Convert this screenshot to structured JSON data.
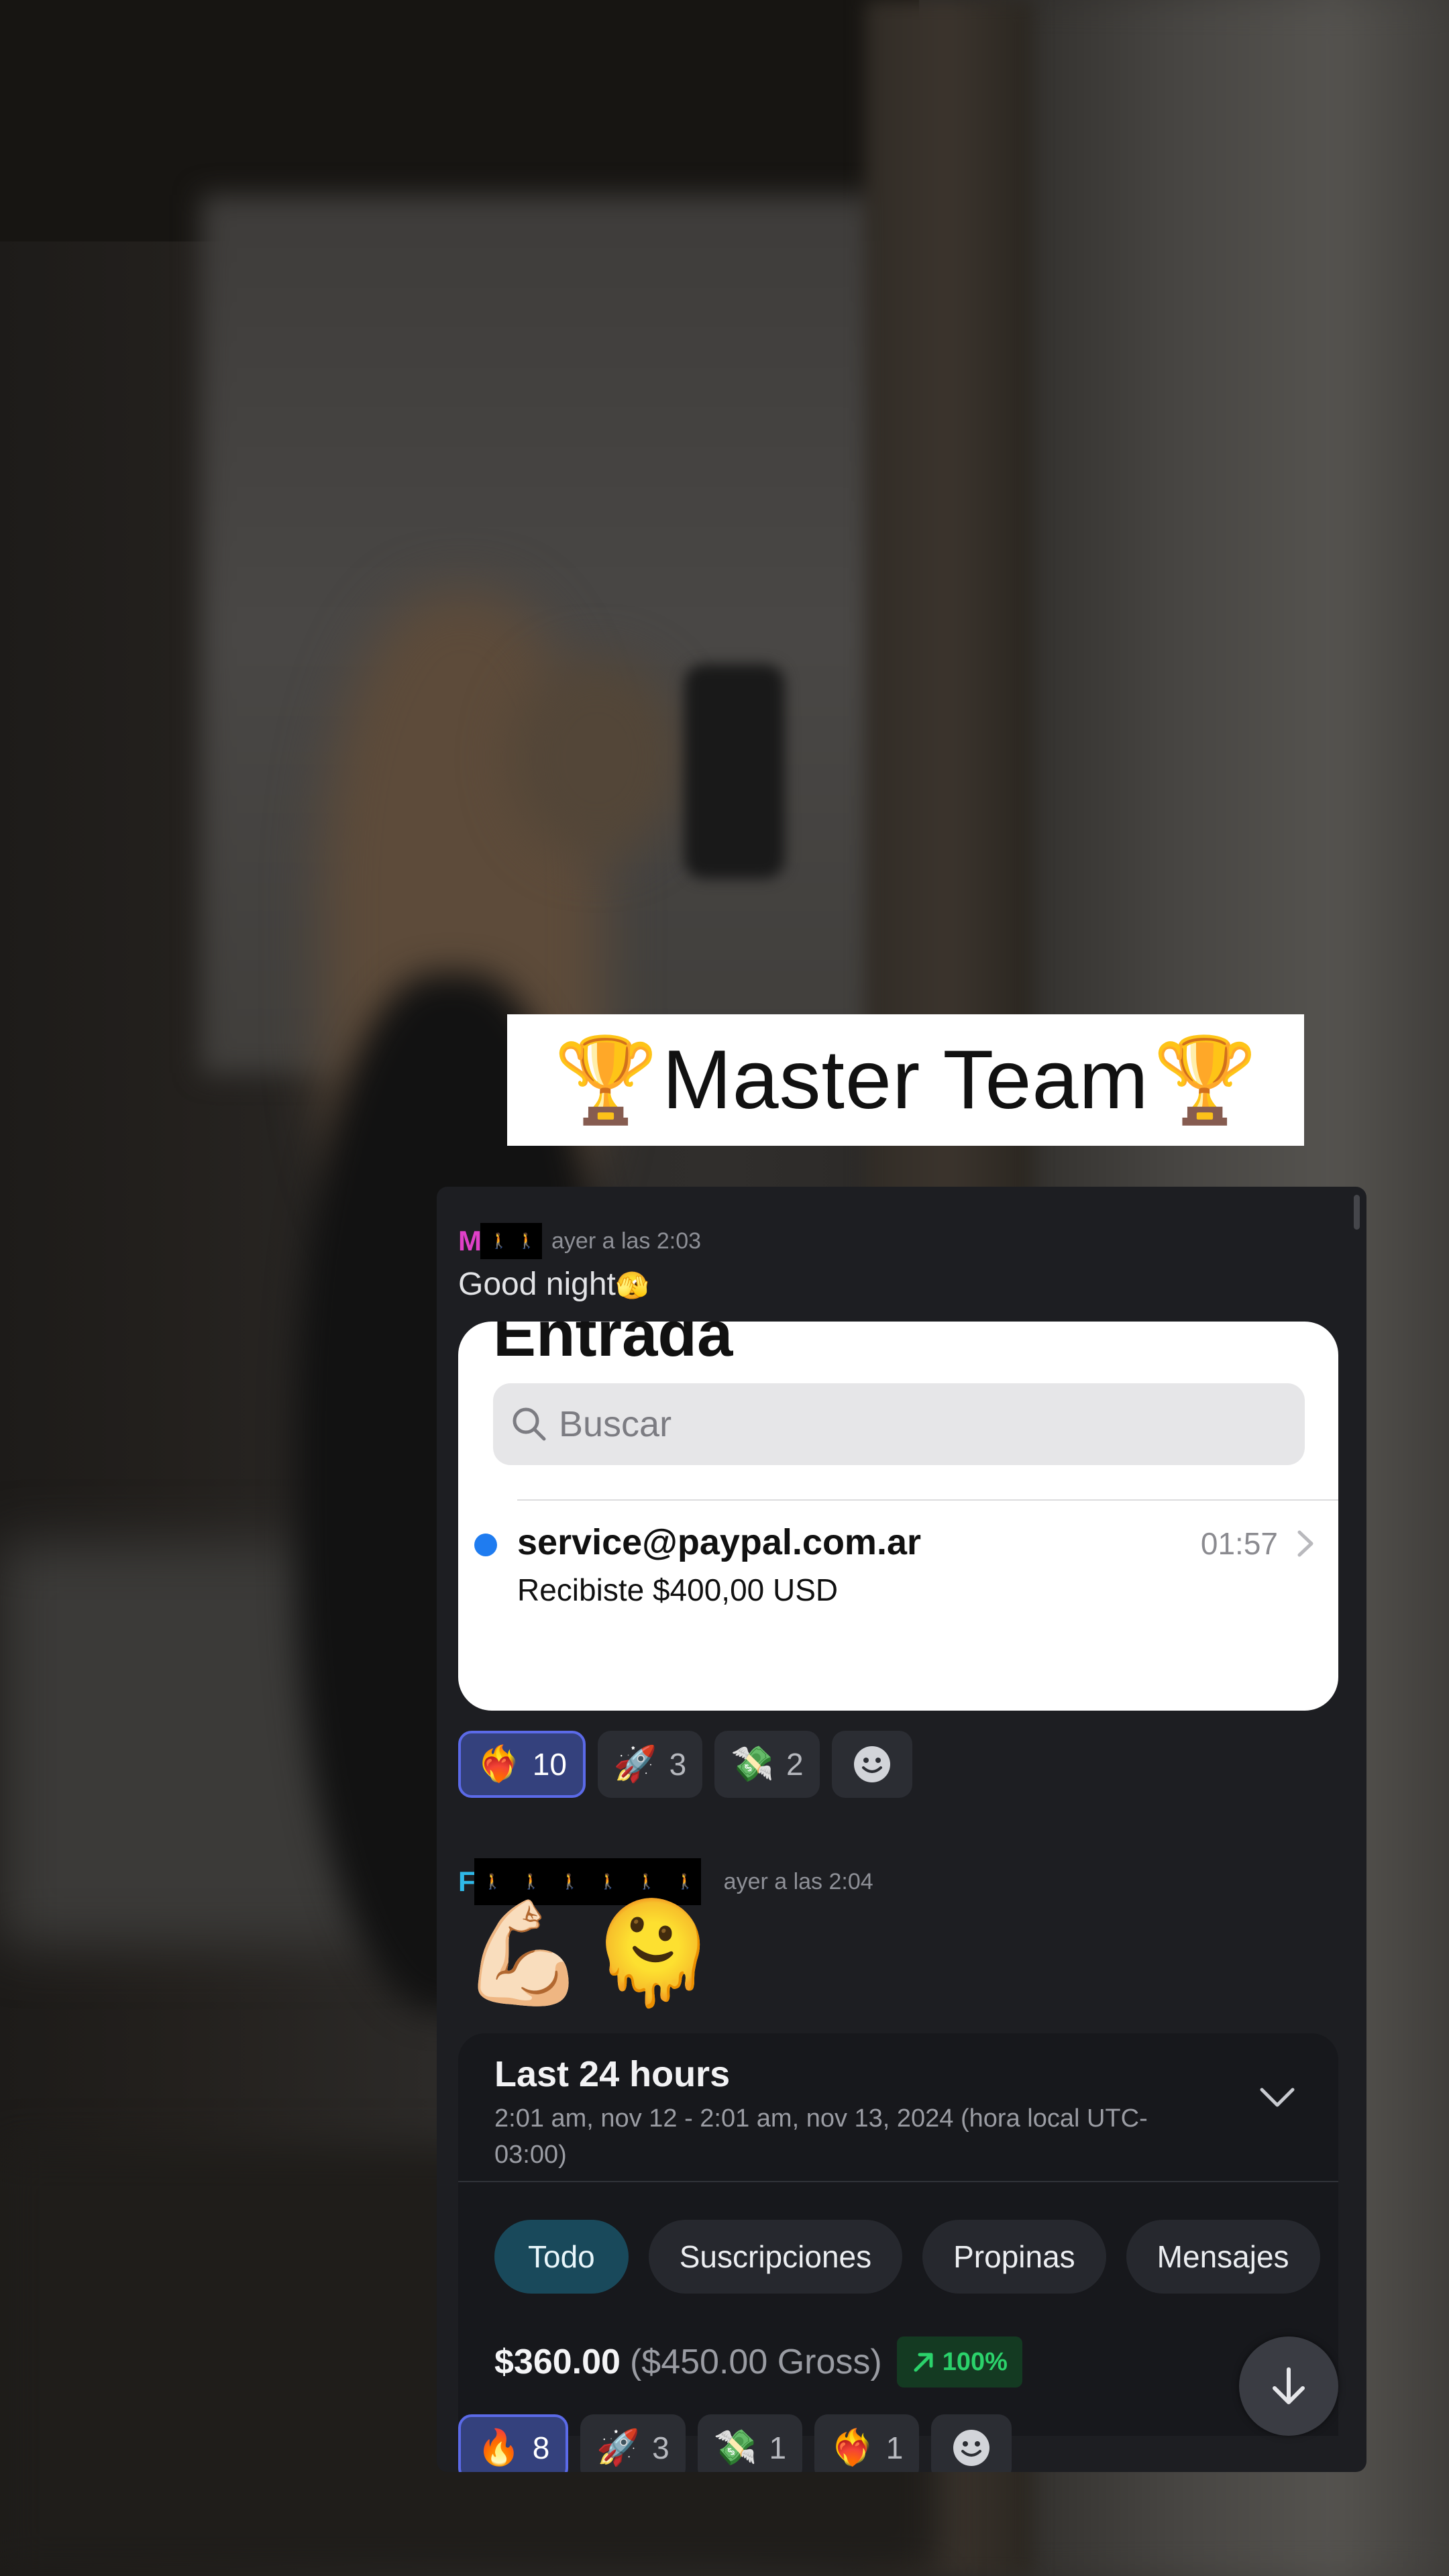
{
  "banner": {
    "title": "Master Team",
    "trophy_icon": "🏆"
  },
  "messages": [
    {
      "author_initial": "M",
      "author_color": "#e040c8",
      "timestamp": "ayer a las 2:03",
      "text": "Good night",
      "text_emoji": "🫣",
      "attachment": {
        "heading": "Entrada",
        "search_placeholder": "Buscar",
        "email": {
          "sender": "service@paypal.com.ar",
          "time": "01:57",
          "preview": "Recibiste $400,00 USD",
          "unread": true
        }
      },
      "reactions": [
        {
          "icon": "❤️‍🔥",
          "count": "10",
          "active": true
        },
        {
          "icon": "🚀",
          "count": "3",
          "active": false
        },
        {
          "icon": "💸",
          "count": "2",
          "active": false
        }
      ]
    },
    {
      "author_initial": "F",
      "author_color": "#2fb9e8",
      "timestamp": "ayer a las 2:04",
      "emojis": [
        "💪🏻",
        "🫠"
      ],
      "attachment": {
        "title": "Last 24 hours",
        "range": "2:01 am, nov 12 - 2:01 am, nov 13, 2024 (hora local UTC-03:00)",
        "filters": [
          "Todo",
          "Suscripciones",
          "Propinas",
          "Mensajes"
        ],
        "selected_filter": "Todo",
        "net": "$360.00",
        "gross": "($450.00 Gross)",
        "growth": "100%"
      },
      "reactions": [
        {
          "icon": "🔥",
          "count": "8",
          "active": true
        },
        {
          "icon": "🚀",
          "count": "3",
          "active": false
        },
        {
          "icon": "💸",
          "count": "1",
          "active": false
        },
        {
          "icon": "❤️‍🔥",
          "count": "1",
          "active": false
        }
      ]
    }
  ],
  "colors": {
    "panel_bg": "#1d1e22",
    "reaction_active": "#34417d",
    "accent_link": "#1f7cf0",
    "growth_green": "#2bd26b"
  }
}
